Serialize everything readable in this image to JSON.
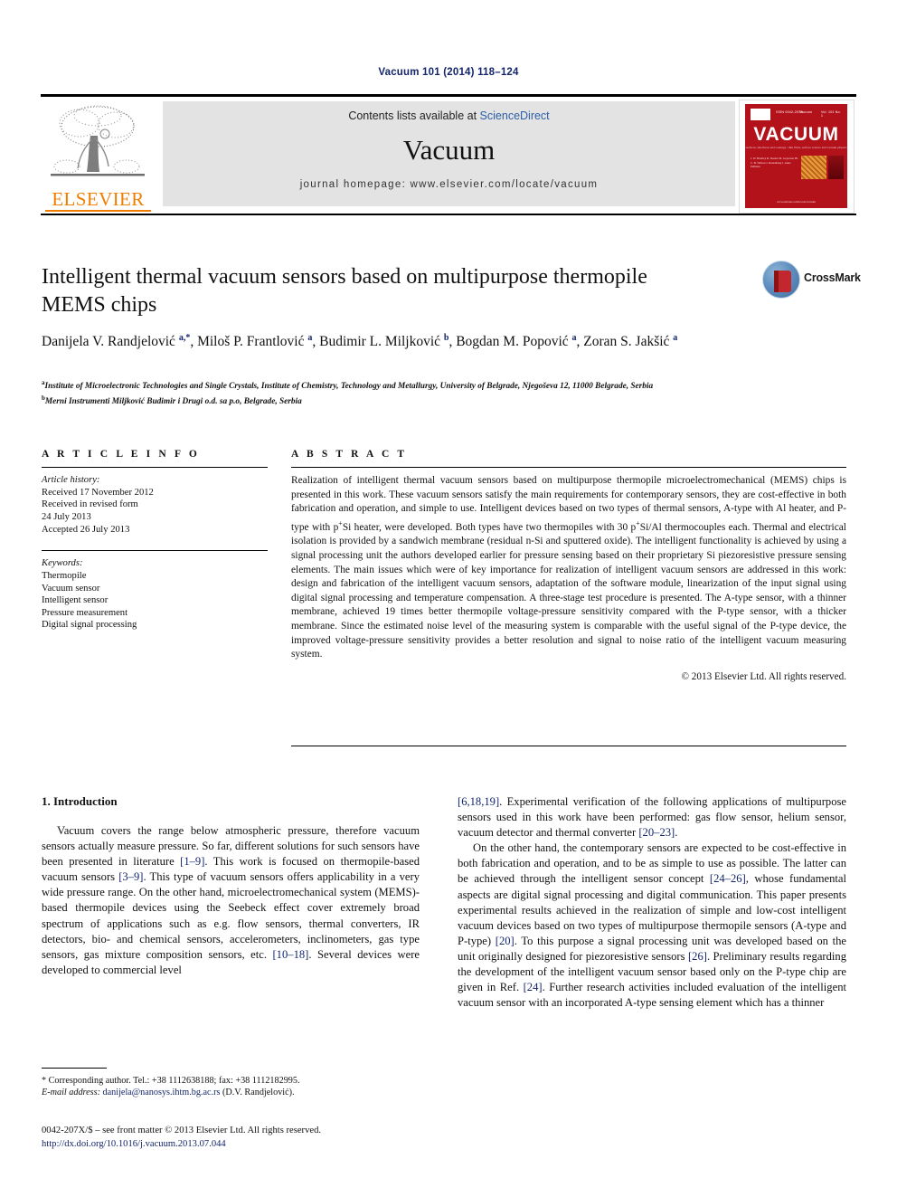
{
  "running_head": "Vacuum 101 (2014) 118–124",
  "masthead": {
    "contents_prefix": "Contents lists available at",
    "sciencedirect": "ScienceDirect",
    "journal_name": "Vacuum",
    "homepage": "journal homepage: www.elsevier.com/locate/vacuum",
    "publisher_logo_text": "ELSEVIER",
    "publisher_logo_name": "elsevier-tree-logo",
    "cover": {
      "title": "VACUUM",
      "subtitle": "surfaces, interfaces and coatings / thin films, surface science and vacuum physics",
      "issue_label_left": "ISSN 0042-207X",
      "issue_label_mid": "Vacuum",
      "issue_label_right": "Vol. 101  No. 1",
      "editors": "Editor-in-Chief\nAssociate Editors\n\nSpecial Issue Editor",
      "editor_names": "J. W. Bradley\nR. Dorner\nM. Geyersen\nPh. C. B. Wilson\nJ. Rodenburg\nJ. Anne Pullman",
      "footer": "www.elsevier.com/locate/vacuum"
    }
  },
  "article": {
    "title": "Intelligent thermal vacuum sensors based on multipurpose thermopile MEMS chips",
    "authors_html": "Danijela V. Randjelović <sup>a,*</sup>, Miloš P. Frantlović <sup>a</sup>, Budimir L. Miljković <sup>b</sup>, Bogdan M. Popović <sup>a</sup>, Zoran S. Jakšić <sup>a</sup>",
    "affiliation_a": "Institute of Microelectronic Technologies and Single Crystals, Institute of Chemistry, Technology and Metallurgy, University of Belgrade, Njegoševa 12, 11000 Belgrade, Serbia",
    "affiliation_b": "Merni Instrumenti Miljković Budimir i Drugi o.d. sa p.o, Belgrade, Serbia",
    "crossmark_label": "CrossMark"
  },
  "article_info": {
    "heading": "A R T I C L E   I N F O",
    "history_label": "Article history:",
    "history": [
      "Received 17 November 2012",
      "Received in revised form",
      "24 July 2013",
      "Accepted 26 July 2013"
    ],
    "keywords_label": "Keywords:",
    "keywords": [
      "Thermopile",
      "Vacuum sensor",
      "Intelligent sensor",
      "Pressure measurement",
      "Digital signal processing"
    ]
  },
  "abstract": {
    "heading": "A B S T R A C T",
    "paragraph_html": "Realization of intelligent thermal vacuum sensors based on multipurpose thermopile microelectromechanical (MEMS) chips is presented in this work. These vacuum sensors satisfy the main requirements for contemporary sensors, they are cost-effective in both fabrication and operation, and simple to use. Intelligent devices based on two types of thermal sensors, A-type with Al heater, and P-type with p<sup>+</sup>Si heater, were developed. Both types have two thermopiles with 30 p<sup>+</sup>Si/Al thermocouples each. Thermal and electrical isolation is provided by a sandwich membrane (residual n-Si and sputtered oxide). The intelligent functionality is achieved by using a signal processing unit the authors developed earlier for pressure sensing based on their proprietary Si piezoresistive pressure sensing elements. The main issues which were of key importance for realization of intelligent vacuum sensors are addressed in this work: design and fabrication of the intelligent vacuum sensors, adaptation of the software module, linearization of the input signal using digital signal processing and temperature compensation. A three-stage test procedure is presented. The A-type sensor, with a thinner membrane, achieved 19 times better thermopile voltage-pressure sensitivity compared with the P-type sensor, with a thicker membrane. Since the estimated noise level of the measuring system is comparable with the useful signal of the P-type device, the improved voltage-pressure sensitivity provides a better resolution and signal to noise ratio of the intelligent vacuum measuring system.",
    "copyright": "© 2013 Elsevier Ltd. All rights reserved."
  },
  "body": {
    "section_number_title": "1.  Introduction",
    "left_p1_html": "Vacuum covers the range below atmospheric pressure, therefore vacuum sensors actually measure pressure. So far, different solutions for such sensors have been presented in literature <span class=\"ref\">[1–9]</span>. This work is focused on thermopile-based vacuum sensors <span class=\"ref\">[3–9]</span>. This type of vacuum sensors offers applicability in a very wide pressure range. On the other hand, microelectromechanical system (MEMS)-based thermopile devices using the Seebeck effect cover extremely broad spectrum of applications such as e.g. flow sensors, thermal converters, IR detectors, bio- and chemical sensors, accelerometers, inclinometers, gas type sensors, gas mixture composition sensors, etc. <span class=\"ref\">[10–18]</span>. Several devices were developed to commercial level",
    "right_p1_html": "<span class=\"ref\">[6,18,19]</span>. Experimental verification of the following applications of multipurpose sensors used in this work have been performed: gas flow sensor, helium sensor, vacuum detector and thermal converter <span class=\"ref\">[20–23]</span>.",
    "right_p2_html": "On the other hand, the contemporary sensors are expected to be cost-effective in both fabrication and operation, and to be as simple to use as possible. The latter can be achieved through the intelligent sensor concept <span class=\"ref\">[24–26]</span>, whose fundamental aspects are digital signal processing and digital communication. This paper presents experimental results achieved in the realization of simple and low-cost intelligent vacuum devices based on two types of multipurpose thermopile sensors (A-type and P-type) <span class=\"ref\">[20]</span>. To this purpose a signal processing unit was developed based on the unit originally designed for piezoresistive sensors <span class=\"ref\">[26]</span>. Preliminary results regarding the development of the intelligent vacuum sensor based only on the P-type chip are given in Ref. <span class=\"ref\">[24]</span>. Further research activities included evaluation of the intelligent vacuum sensor with an incorporated A-type sensing element which has a thinner"
  },
  "footnote": {
    "corresponding_html": "* Corresponding author. Tel.: +38 1112638188; fax: +38 1112182995.",
    "email_html": "<span class=\"fn-italic\">E-mail address:</span> <span class=\"link\">danijela@nanosys.ihtm.bg.ac.rs</span> (D.V. Randjelović)."
  },
  "footer": {
    "line1_html": "0042-207X/$ – see front matter © 2013 Elsevier Ltd. All rights reserved.",
    "doi": "http://dx.doi.org/10.1016/j.vacuum.2013.07.044"
  },
  "colors": {
    "link_blue": "#13256b",
    "sciencedirect_blue": "#2b5fa8",
    "elsevier_orange": "#f07d00",
    "cover_red": "#b3121b",
    "band_grey": "#e3e3e3"
  }
}
